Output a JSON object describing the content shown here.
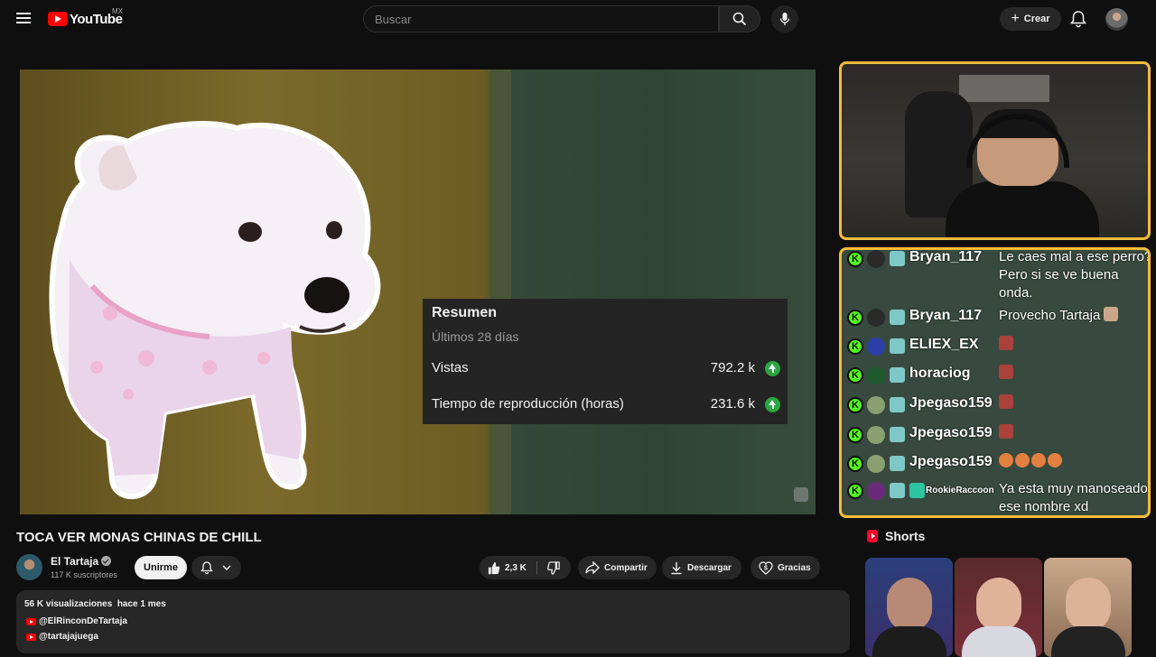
{
  "header": {
    "logo_text": "YouTube",
    "country_code": "MX",
    "search_placeholder": "Buscar",
    "create_label": "Crear"
  },
  "video": {
    "summary": {
      "title": "Resumen",
      "period": "Últimos 28 días",
      "rows": [
        {
          "label": "Vistas",
          "value": "792.2 k"
        },
        {
          "label": "Tiempo de reproducción (horas)",
          "value": "231.6 k"
        }
      ]
    }
  },
  "title": "TOCA VER MONAS CHINAS DE CHILL",
  "channel": {
    "name": "El Tartaja",
    "subscribers": "117 K suscriptores",
    "join_label": "Unirme"
  },
  "actions": {
    "likes": "2,3 K",
    "share": "Compartir",
    "download": "Descargar",
    "thanks": "Gracias"
  },
  "description": {
    "meta": "56 K visualizaciones  hace 1 mes",
    "links": [
      "@ElRinconDeTartaja",
      "@tartajajuega"
    ]
  },
  "chat": {
    "messages": [
      {
        "user": "Bryan_117",
        "text": "Le caes mal a ese perro? Pero si se ve buena onda."
      },
      {
        "user": "Bryan_117",
        "text": "Provecho Tartaja"
      },
      {
        "user": "ELIEX_EX",
        "text": ""
      },
      {
        "user": "horaciog",
        "text": ""
      },
      {
        "user": "Jpegaso159",
        "text": ""
      },
      {
        "user": "Jpegaso159",
        "text": ""
      },
      {
        "user": "Jpegaso159",
        "text": ""
      },
      {
        "user": "RookieRaccoon",
        "text": "Ya esta muy manoseado ese nombre xd"
      }
    ]
  },
  "shorts": {
    "title": "Shorts"
  },
  "colors": {
    "accent_red": "#ff0000",
    "frame_yellow": "#f4bd3a",
    "kick_green": "#53fc18",
    "trend_green": "#2ba640"
  }
}
